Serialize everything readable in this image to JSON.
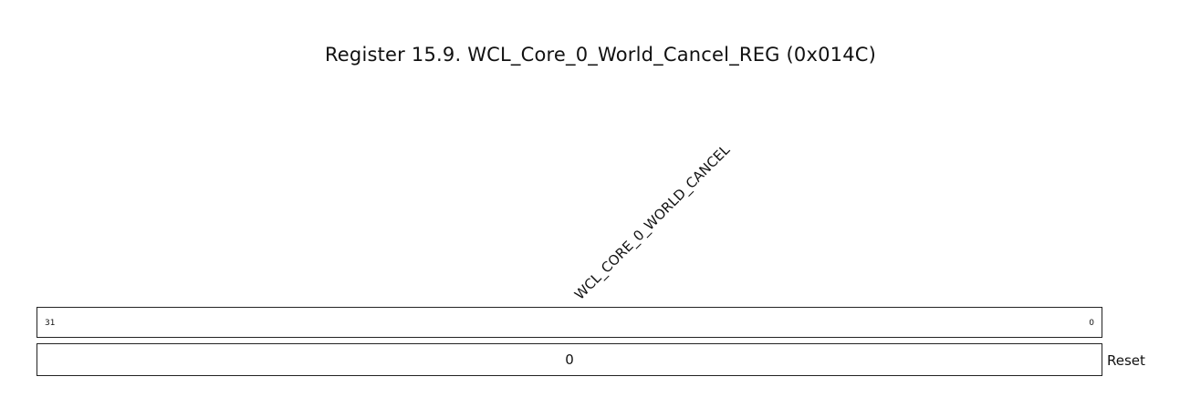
{
  "title": "Register 15.9. WCL_Core_0_World_Cancel_REG (0x014C)",
  "field": {
    "name": "WCL_CORE_0_WORLD_CANCEL",
    "bit_high": "31",
    "bit_low": "0",
    "reset_value": "0"
  },
  "reset_label": "Reset"
}
